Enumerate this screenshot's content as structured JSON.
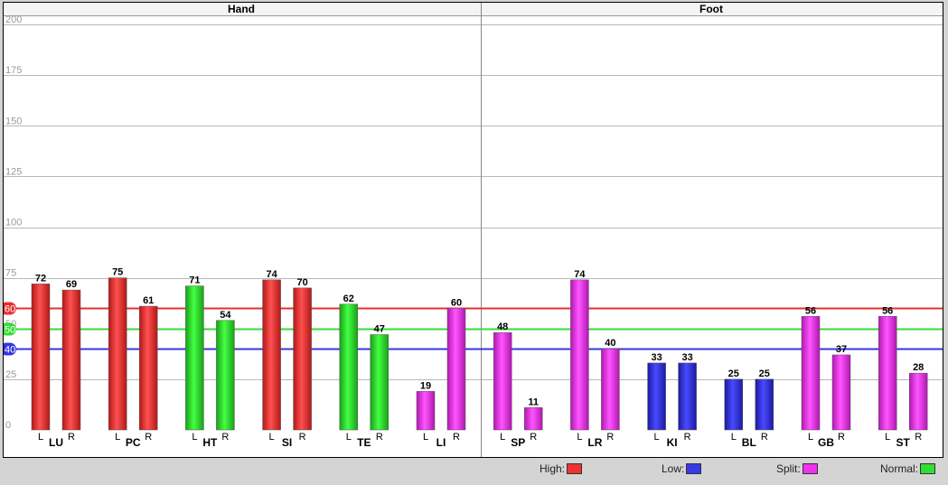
{
  "chart_data": {
    "type": "bar",
    "panels": [
      "Hand",
      "Foot"
    ],
    "ylim": [
      0,
      200
    ],
    "y_ticks": [
      0,
      25,
      50,
      75,
      100,
      125,
      150,
      175,
      200
    ],
    "reference_lines": [
      {
        "value": 60,
        "label": "60",
        "color": "#e53030"
      },
      {
        "value": 50,
        "label": "50",
        "color": "#33dd33"
      },
      {
        "value": 40,
        "label": "40",
        "color": "#3535e6"
      }
    ],
    "groups": [
      {
        "name": "LU",
        "panel": "Hand",
        "bars": [
          {
            "side": "L",
            "value": 72,
            "status": "High"
          },
          {
            "side": "R",
            "value": 69,
            "status": "High"
          }
        ]
      },
      {
        "name": "PC",
        "panel": "Hand",
        "bars": [
          {
            "side": "L",
            "value": 75,
            "status": "High"
          },
          {
            "side": "R",
            "value": 61,
            "status": "High"
          }
        ]
      },
      {
        "name": "HT",
        "panel": "Hand",
        "bars": [
          {
            "side": "L",
            "value": 71,
            "status": "Normal"
          },
          {
            "side": "R",
            "value": 54,
            "status": "Normal"
          }
        ]
      },
      {
        "name": "SI",
        "panel": "Hand",
        "bars": [
          {
            "side": "L",
            "value": 74,
            "status": "High"
          },
          {
            "side": "R",
            "value": 70,
            "status": "High"
          }
        ]
      },
      {
        "name": "TE",
        "panel": "Hand",
        "bars": [
          {
            "side": "L",
            "value": 62,
            "status": "Normal"
          },
          {
            "side": "R",
            "value": 47,
            "status": "Normal"
          }
        ]
      },
      {
        "name": "LI",
        "panel": "Hand",
        "bars": [
          {
            "side": "L",
            "value": 19,
            "status": "Split"
          },
          {
            "side": "R",
            "value": 60,
            "status": "Split"
          }
        ]
      },
      {
        "name": "SP",
        "panel": "Foot",
        "bars": [
          {
            "side": "L",
            "value": 48,
            "status": "Split"
          },
          {
            "side": "R",
            "value": 11,
            "status": "Split"
          }
        ]
      },
      {
        "name": "LR",
        "panel": "Foot",
        "bars": [
          {
            "side": "L",
            "value": 74,
            "status": "Split"
          },
          {
            "side": "R",
            "value": 40,
            "status": "Split"
          }
        ]
      },
      {
        "name": "KI",
        "panel": "Foot",
        "bars": [
          {
            "side": "L",
            "value": 33,
            "status": "Low"
          },
          {
            "side": "R",
            "value": 33,
            "status": "Low"
          }
        ]
      },
      {
        "name": "BL",
        "panel": "Foot",
        "bars": [
          {
            "side": "L",
            "value": 25,
            "status": "Low"
          },
          {
            "side": "R",
            "value": 25,
            "status": "Low"
          }
        ]
      },
      {
        "name": "GB",
        "panel": "Foot",
        "bars": [
          {
            "side": "L",
            "value": 56,
            "status": "Split"
          },
          {
            "side": "R",
            "value": 37,
            "status": "Split"
          }
        ]
      },
      {
        "name": "ST",
        "panel": "Foot",
        "bars": [
          {
            "side": "L",
            "value": 56,
            "status": "Split"
          },
          {
            "side": "R",
            "value": 28,
            "status": "Split"
          }
        ]
      }
    ],
    "legend": [
      {
        "label": "High:",
        "status": "High",
        "color": "#ee3333"
      },
      {
        "label": "Low:",
        "status": "Low",
        "color": "#3838e8"
      },
      {
        "label": "Split:",
        "status": "Split",
        "color": "#ee33ee"
      },
      {
        "label": "Normal:",
        "status": "Normal",
        "color": "#33dd33"
      }
    ]
  }
}
